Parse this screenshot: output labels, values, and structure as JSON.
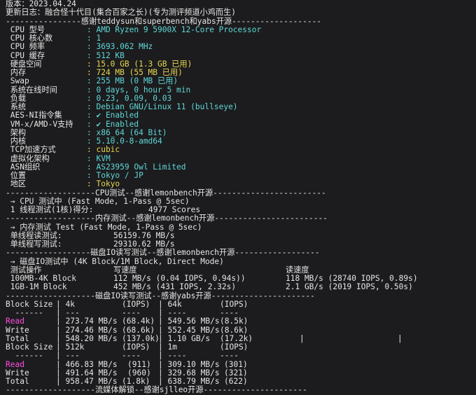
{
  "header": {
    "version": "版本：2023.04.24",
    "changelog": "更新日志：融合怪十代目(集合百家之长)(专为测评频道小鸡而生)",
    "sep_sysinfo": "----------------感谢teddysun和superbench和yabs开源-------------------"
  },
  "sysinfo": [
    {
      "label": " CPU 型号",
      "value": ": AMD Ryzen 9 5900X 12-Core Processor",
      "color": "cyan"
    },
    {
      "label": " CPU 核心数",
      "value": ": 1",
      "color": "cyan"
    },
    {
      "label": " CPU 频率",
      "value": ": 3693.062 MHz",
      "color": "cyan"
    },
    {
      "label": " CPU 缓存",
      "value": ": 512 KB",
      "color": "cyan"
    },
    {
      "label": " 硬盘空间",
      "value": ": 15.0 GB (1.3 GB 已用)",
      "color": "yellow"
    },
    {
      "label": " 内存",
      "value": ": 724 MB (55 MB 已用)",
      "color": "yellow"
    },
    {
      "label": " Swap",
      "value": ": 255 MB (0 MB 已用)",
      "color": "cyan"
    },
    {
      "label": " 系统在线时间",
      "value": ": 0 days, 0 hour 5 min",
      "color": "cyan"
    },
    {
      "label": " 负载",
      "value": ": 0.23, 0.09, 0.03",
      "color": "cyan"
    },
    {
      "label": " 系统",
      "value": ": Debian GNU/Linux 11 (bullseye)",
      "color": "cyan"
    },
    {
      "label": " AES-NI指令集",
      "value": ": ✔ Enabled",
      "color": "cyan"
    },
    {
      "label": " VM-x/AMD-V支持",
      "value": ": ✔ Enabled",
      "color": "cyan"
    },
    {
      "label": " 架构",
      "value": ": x86_64 (64 Bit)",
      "color": "cyan"
    },
    {
      "label": " 内核",
      "value": ": 5.10.0-8-amd64",
      "color": "cyan"
    },
    {
      "label": " TCP加速方式",
      "value": ": cubic",
      "color": "yellow"
    },
    {
      "label": " 虚拟化架构",
      "value": ": KVM",
      "color": "cyan"
    },
    {
      "label": " ASN组织",
      "value": ": AS23959 Owl Limited",
      "color": "cyan"
    },
    {
      "label": " 位置",
      "value": ": Tokyo / JP",
      "color": "cyan"
    },
    {
      "label": " 地区",
      "value": ": Tokyo",
      "color": "yellow"
    }
  ],
  "cpu_test": {
    "sep": "-------------------CPU测试--感谢lemonbench开源------------------------",
    "title": " → CPU 测试中 (Fast Mode, 1-Pass @ 5sec)",
    "label": " 1 线程测试(1核)得分:",
    "score": "4977 Scores"
  },
  "mem_test": {
    "sep": "-------------------内存测试--感谢lemonbench开源------------------------",
    "title": " → 内存测试 Test (Fast Mode, 1-Pass @ 5sec)",
    "read_label": " 单线程读测试:",
    "read_value": "56159.76 MB/s",
    "write_label": " 单线程写测试:",
    "write_value": "29310.62 MB/s"
  },
  "disk_test": {
    "sep": "------------------磁盘IO读写测试--感谢lemonbench开源------------------",
    "title": " → 磁盘IO测试中 (4K Block/1M Block, Direct Mode)",
    "col_op": " 测试操作",
    "col_write": "写速度",
    "col_read": "读速度",
    "rows": [
      {
        "op": " 100MB-4K Block",
        "write": "112 MB/s (0.04 IOPS, 0.94s))",
        "read": "118 MB/s (28740 IOPS, 0.89s)"
      },
      {
        "op": " 1GB-1M Block",
        "write": "452 MB/s (431 IOPS, 2.32s)",
        "read": "2.1 GB/s (2019 IOPS, 0.50s)"
      }
    ]
  },
  "yabs": {
    "sep": "-------------------磁盘IO读写测试--感谢yabs开源----------------------",
    "blocks": [
      {
        "header": [
          "Block Size",
          "| 4k",
          "(IOPS)",
          "| 64k",
          "(IOPS)"
        ],
        "dashes": [
          "  ------",
          "| ---",
          "----",
          "| ----",
          "----"
        ],
        "rows": [
          {
            "label": "Read",
            "magenta": true,
            "c1": "| 273.74 MB/s",
            "c2": "(68.4k)",
            "c3": "| 549.56 MB/s",
            "c4": "(8.5k)"
          },
          {
            "label": "Write",
            "magenta": false,
            "c1": "| 274.46 MB/s",
            "c2": "(68.6k)",
            "c3": "| 552.45 MB/s",
            "c4": "(8.6k)"
          },
          {
            "label": "Total",
            "magenta": false,
            "c1": "| 548.20 MB/s",
            "c2": "(137.0k)",
            "c3": "| 1.10 GB/s",
            "c4": "(17.2k)"
          }
        ]
      },
      {
        "header": [
          "Block Size",
          "| 512k",
          "(IOPS)",
          "| 1m",
          "(IOPS)"
        ],
        "dashes": [
          "  ------",
          "| ---",
          "----",
          "| ----",
          "----"
        ],
        "rows": [
          {
            "label": "Read",
            "magenta": true,
            "c1": "| 466.83 MB/s",
            "c2": "(911)",
            "c3": "| 309.10 MB/s",
            "c4": "(301)"
          },
          {
            "label": "Write",
            "magenta": false,
            "c1": "| 491.64 MB/s",
            "c2": "(960)",
            "c3": "| 329.68 MB/s",
            "c4": "(321)"
          },
          {
            "label": "Total",
            "magenta": false,
            "c1": "| 958.47 MB/s",
            "c2": "(1.8k)",
            "c3": "| 638.79 MB/s",
            "c4": "(622)"
          }
        ]
      }
    ],
    "cursor_marks": [
      "|",
      "|"
    ]
  },
  "footer_sep": "-------------------流媒体解锁--感谢sjlleo开源----------------------"
}
